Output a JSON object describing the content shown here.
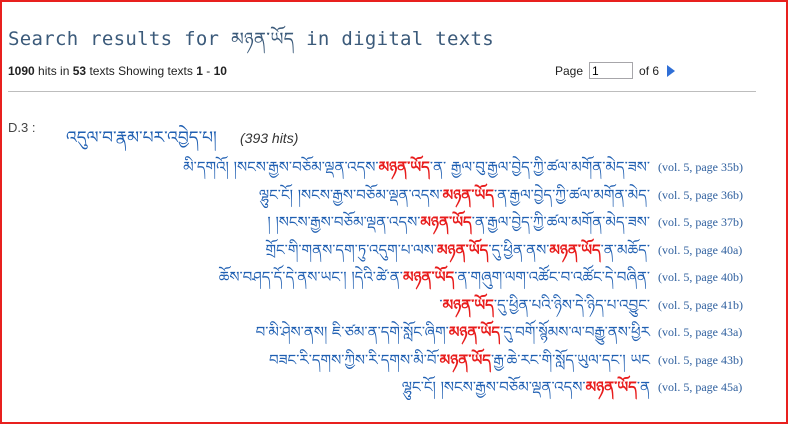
{
  "header": {
    "title_prefix": "Search results for",
    "query": "མཉན་ཡོད",
    "title_suffix": "in digital texts"
  },
  "summary": {
    "hits": "1090",
    "hits_label": "hits in",
    "texts": "53",
    "texts_label": "texts Showing texts",
    "range_start": "1",
    "range_sep": "-",
    "range_end": "10"
  },
  "pager": {
    "label": "Page",
    "current": "1",
    "of_label": "of 6"
  },
  "text": {
    "id": "D.3 :",
    "title": "འདུལ་བ་རྣམ་པར་འབྱེད་པ།",
    "hits": "(393 hits)"
  },
  "results": [
    {
      "pre": "མི་དགའོ། །སངས་རྒྱས་བཅོམ་ལྡན་འདས་",
      "hit": "མཉན་ཡོད",
      "post": "་ན་ རྒྱལ་བུ་རྒྱལ་བྱེད་ཀྱི་ཚལ་མགོན་མེད་ཟས་",
      "ref": "(vol. 5, page 35b)"
    },
    {
      "pre": "ལྷུང་ངོ། །སངས་རྒྱས་བཅོམ་ལྡན་འདས་",
      "hit": "མཉན་ཡོད",
      "post": "་ན་རྒྱལ་བྱེད་ཀྱི་ཚལ་མགོན་མེད་",
      "ref": "(vol. 5, page 36b)"
    },
    {
      "pre": "། །སངས་རྒྱས་བཅོམ་ལྡན་འདས་",
      "hit": "མཉན་ཡོད",
      "post": "་ན་རྒྱལ་བྱེད་ཀྱི་ཚལ་མགོན་མེད་ཟས་",
      "ref": "(vol. 5, page 37b)"
    },
    {
      "pre": "གྲོང་གི་གནས་དག་ཏུ་འདུག་པ་ལས་",
      "hit": "མཉན་ཡོད",
      "post": "་དུ་ཕྱིན་ནས་",
      "hit2": "མཉན་ཡོད",
      "post2": "་ན་མཆོད་",
      "ref": "(vol. 5, page 40a)"
    },
    {
      "pre": "ཆོས་བཤད་དོ་དེ་ནས་ཡང་། །དེའི་ཚེ་ན་",
      "hit": "མཉན་ཡོད",
      "post": "་ན་གཞུག་ལག་འཚོང་བ་འཚོང་དེ་བཞིན་",
      "ref": "(vol. 5, page 40b)"
    },
    {
      "pre": "་",
      "hit": "མཉན་ཡོད",
      "post": "་དུ་ཕྱིན་པའི་ཉིས་དེ་ཉིད་པ་འབྱུང་",
      "ref": "(vol. 5, page 41b)"
    },
    {
      "pre": "བ་མི་ཤེས་ནས། ཇི་ཙམ་ན་དགེ་སློང་ཞིག་",
      "hit": "མཉན་ཡོད",
      "post": "་དུ་བགོ་སྙོམས་ལ་བརྒྱུ་ནས་ཕྱིར",
      "ref": "(vol. 5, page 43a)"
    },
    {
      "pre": "བཟང་རི་དགས་ཀྱིས་རི་དགས་མི་བོ་",
      "hit": "མཉན་ཡོད",
      "post": "་རྒྱ་ཆེ་རང་གི་སློད་ཡུལ་དང་། ཡང",
      "ref": "(vol. 5, page 43b)"
    },
    {
      "pre": "ལྷུང་ངོ། །སངས་རྒྱས་བཅོམ་ལྡན་འདས་",
      "hit": "མཉན་ཡོད",
      "post": "་ན",
      "ref": "(vol. 5, page 45a)"
    }
  ]
}
